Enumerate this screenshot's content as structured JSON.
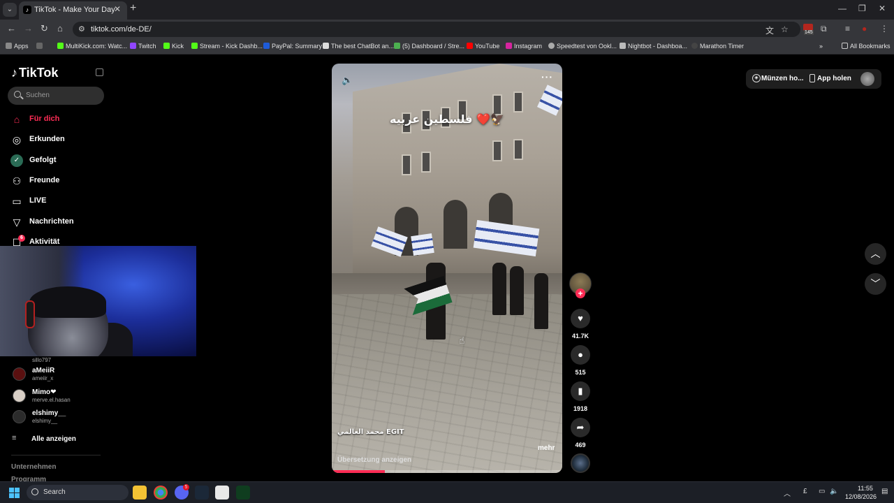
{
  "browser": {
    "tab_title": "TikTok - Make Your Day",
    "url": "tiktok.com/de-DE/",
    "extension_badge": "145",
    "bookmarks": [
      "Apps",
      "MultiKick.com: Watc...",
      "Twitch",
      "Kick",
      "Stream - Kick Dashb...",
      "PayPal: Summary",
      "The best ChatBot an...",
      "(5) Dashboard / Stre...",
      "YouTube",
      "Instagram",
      "Speedtest von Ookl...",
      "Nightbot - Dashboa...",
      "Marathon Timer"
    ],
    "all_bookmarks": "All Bookmarks"
  },
  "sidebar": {
    "logo": "TikTok",
    "search_placeholder": "Suchen",
    "nav": [
      {
        "label": "Für dich",
        "icon": "home-icon"
      },
      {
        "label": "Erkunden",
        "icon": "compass-icon"
      },
      {
        "label": "Gefolgt",
        "icon": "following-icon"
      },
      {
        "label": "Freunde",
        "icon": "friends-icon"
      },
      {
        "label": "LIVE",
        "icon": "live-icon"
      },
      {
        "label": "Nachrichten",
        "icon": "messages-icon"
      },
      {
        "label": "Aktivität",
        "icon": "activity-icon"
      }
    ],
    "activity_badge": "6",
    "following": [
      {
        "name": "aMeiiR",
        "handle": "ameiir_x"
      },
      {
        "name": "Mimo❤",
        "handle": "merve.el.hasan"
      },
      {
        "name": "elshimy__",
        "handle": "elshimy__"
      }
    ],
    "partial_handle": "sillo797",
    "show_all": "Alle anzeigen",
    "footer": [
      "Unternehmen",
      "Programm"
    ]
  },
  "video": {
    "overlay_text": "فلسطين عربيه ❤️🦅",
    "author": "محمد العالمي EGIT",
    "more": "mehr",
    "translate": "Übersetzung anzeigen",
    "progress": 0.23
  },
  "actions": {
    "likes": "41.7K",
    "comments": "515",
    "saves": "1918",
    "shares": "469"
  },
  "header": {
    "coins": "Münzen ho...",
    "get_app": "App holen"
  },
  "taskbar": {
    "search": "Search",
    "time": "11:55",
    "date": "12/08/2026",
    "discord_badge": "5"
  }
}
